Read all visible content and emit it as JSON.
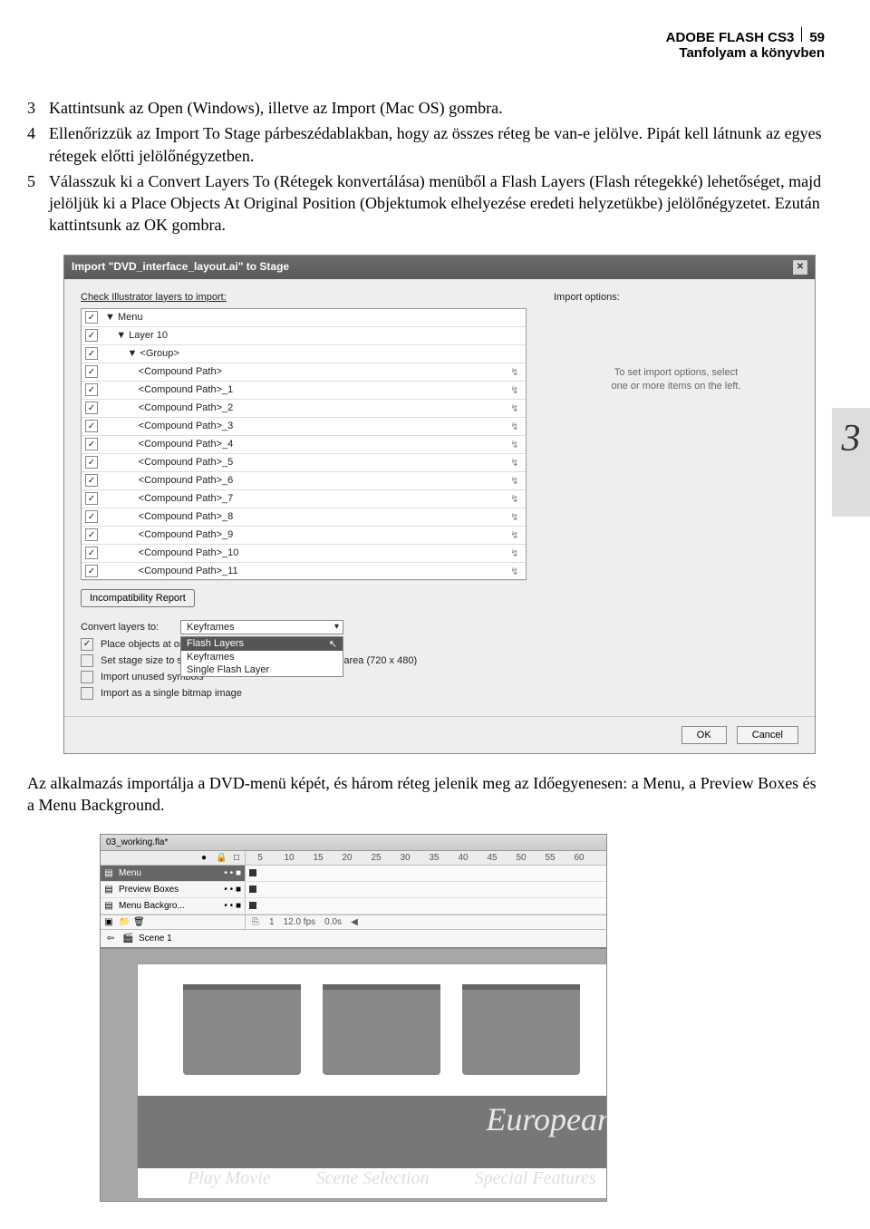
{
  "header": {
    "title": "ADOBE FLASH CS3",
    "page_number": "59",
    "subtitle": "Tanfolyam a könyvben"
  },
  "chapter_tab": "3",
  "steps": [
    {
      "n": "3",
      "t": "Kattintsunk az Open (Windows), illetve az Import (Mac OS) gombra."
    },
    {
      "n": "4",
      "t": "Ellenőrizzük az Import To Stage párbeszédablakban, hogy az összes réteg be van-e jelölve. Pipát kell látnunk az egyes rétegek előtti jelölőnégyzetben."
    },
    {
      "n": "5",
      "t": "Válasszuk ki a Convert Layers To (Rétegek konvertálása) menüből a Flash Layers (Flash rétegekké) lehetőséget, majd jelöljük ki a Place Objects At Original Position (Objektumok elhelyezése eredeti helyzetükbe) jelölőnégyzetet. Ezután kattintsunk az OK gombra."
    }
  ],
  "paragraph_after": "Az alkalmazás importálja a DVD-menü képét, és három réteg jelenik meg az Időegyenesen: a Menu, a Preview Boxes és a Menu Background.",
  "dialog": {
    "title": "Import \"DVD_interface_layout.ai\" to Stage",
    "left_label": "Check Illustrator layers to import:",
    "right_label": "Import options:",
    "hint": "To set import options, select\none or more items on the left.",
    "rows": [
      {
        "indent": 0,
        "label": "Menu",
        "icon": ""
      },
      {
        "indent": 1,
        "label": "Layer 10",
        "icon": ""
      },
      {
        "indent": 2,
        "label": "<Group>",
        "icon": ""
      },
      {
        "indent": 3,
        "label": "<Compound Path>",
        "icon": "↯"
      },
      {
        "indent": 3,
        "label": "<Compound Path>_1",
        "icon": "↯"
      },
      {
        "indent": 3,
        "label": "<Compound Path>_2",
        "icon": "↯"
      },
      {
        "indent": 3,
        "label": "<Compound Path>_3",
        "icon": "↯"
      },
      {
        "indent": 3,
        "label": "<Compound Path>_4",
        "icon": "↯"
      },
      {
        "indent": 3,
        "label": "<Compound Path>_5",
        "icon": "↯"
      },
      {
        "indent": 3,
        "label": "<Compound Path>_6",
        "icon": "↯"
      },
      {
        "indent": 3,
        "label": "<Compound Path>_7",
        "icon": "↯"
      },
      {
        "indent": 3,
        "label": "<Compound Path>_8",
        "icon": "↯"
      },
      {
        "indent": 3,
        "label": "<Compound Path>_9",
        "icon": "↯"
      },
      {
        "indent": 3,
        "label": "<Compound Path>_10",
        "icon": "↯"
      },
      {
        "indent": 3,
        "label": "<Compound Path>_11",
        "icon": "↯"
      }
    ],
    "incompat": "Incompatibility Report",
    "convert_label": "Convert layers to:",
    "convert_value": "Keyframes",
    "convert_options": [
      "Flash Layers",
      "Keyframes",
      "Single Flash Layer"
    ],
    "convert_selected_index": 0,
    "place_cb": "Place objects at original position",
    "stage_cb": "Set stage size to same size as Illustrator artboard/crop area (720 x 480)",
    "unused_cb": "Import unused symbols",
    "bitmap_cb": "Import as a single bitmap image",
    "ok": "OK",
    "cancel": "Cancel"
  },
  "timeline": {
    "file": "03_working.fla*",
    "ruler": [
      "5",
      "10",
      "15",
      "20",
      "25",
      "30",
      "35",
      "40",
      "45",
      "50",
      "55",
      "60"
    ],
    "layers": [
      "Menu",
      "Preview Boxes",
      "Menu Backgro..."
    ],
    "footer": {
      "frame": "1",
      "fps": "12.0 fps",
      "time": "0.0s"
    },
    "scene": "Scene 1"
  },
  "stage": {
    "title": "European Ho",
    "nav": [
      "Play Movie",
      "Scene Selection",
      "Special Features"
    ]
  }
}
